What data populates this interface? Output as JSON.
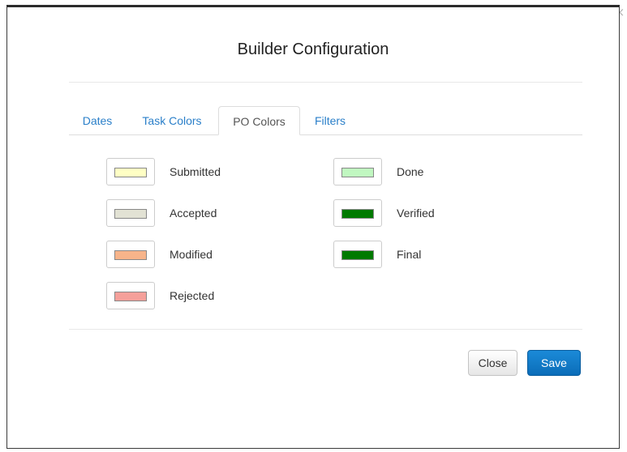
{
  "dialog": {
    "title": "Builder Configuration",
    "close_glyph": "×"
  },
  "tabs": [
    {
      "label": "Dates",
      "active": false
    },
    {
      "label": "Task Colors",
      "active": false
    },
    {
      "label": "PO Colors",
      "active": true
    },
    {
      "label": "Filters",
      "active": false
    }
  ],
  "po_colors": {
    "left": [
      {
        "label": "Submitted",
        "color": "#ffffc4"
      },
      {
        "label": "Accepted",
        "color": "#e2e2d4"
      },
      {
        "label": "Modified",
        "color": "#f7b48a"
      },
      {
        "label": "Rejected",
        "color": "#f5a09a"
      }
    ],
    "right": [
      {
        "label": "Done",
        "color": "#c0f7c0"
      },
      {
        "label": "Verified",
        "color": "#007a00"
      },
      {
        "label": "Final",
        "color": "#007a00"
      }
    ]
  },
  "footer": {
    "close_label": "Close",
    "save_label": "Save"
  },
  "colors": {
    "link": "#2a7fc9",
    "primary": "#1380d0"
  }
}
